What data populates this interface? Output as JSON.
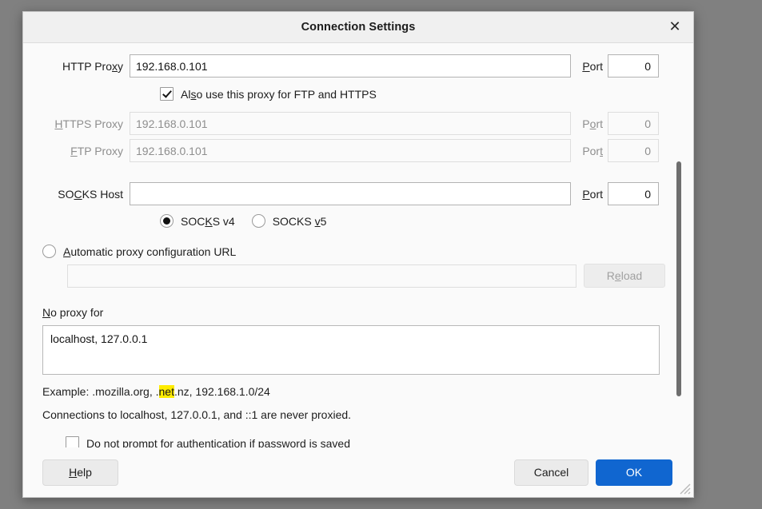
{
  "window": {
    "title": "Connection Settings",
    "close_icon": "close-icon",
    "close_label": "✕"
  },
  "proxy": {
    "http": {
      "label_pre": "HTTP Pro",
      "label_acc": "x",
      "label_post": "y",
      "value": "192.168.0.101",
      "port_pre": "",
      "port_acc": "P",
      "port_post": "ort",
      "port_value": "0"
    },
    "also_use": {
      "pre": "Al",
      "acc": "s",
      "post": "o use this proxy for FTP and HTTPS",
      "checked": true
    },
    "https": {
      "label_pre": "",
      "label_acc": "H",
      "label_post": "TTPS Proxy",
      "value": "192.168.0.101",
      "port_pre": "P",
      "port_acc": "o",
      "port_post": "rt",
      "port_value": "0",
      "disabled": true
    },
    "ftp": {
      "label_pre": "",
      "label_acc": "F",
      "label_post": "TP Proxy",
      "value": "192.168.0.101",
      "port_pre": "Por",
      "port_acc": "t",
      "port_post": "",
      "port_value": "0",
      "disabled": true
    },
    "socks": {
      "label_pre": "SO",
      "label_acc": "C",
      "label_post": "KS Host",
      "value": "",
      "port_pre": "",
      "port_acc": "P",
      "port_post": "ort",
      "port_value": "0"
    },
    "socks_v4": {
      "pre": "SOC",
      "acc": "K",
      "post": "S v4",
      "selected": true
    },
    "socks_v5": {
      "pre": "SOCKS ",
      "acc": "v",
      "post": "5",
      "selected": false
    }
  },
  "auto_config": {
    "radio_pre": "",
    "radio_acc": "A",
    "radio_post": "utomatic proxy configuration URL",
    "selected": false,
    "url_value": "",
    "reload_pre": "R",
    "reload_acc": "e",
    "reload_post": "load",
    "disabled": true
  },
  "no_proxy": {
    "label_pre": "",
    "label_acc": "N",
    "label_post": "o proxy for",
    "value": "localhost, 127.0.0.1",
    "example_pre": "Example: .mozilla.org, .",
    "example_highlight": "net",
    "example_post": ".nz, 192.168.1.0/24",
    "highlight_color": "#ffec00",
    "never_proxied": "Connections to localhost, 127.0.0.1, and ::1 are never proxied."
  },
  "no_prompt": {
    "pre": "Do not prompt for authent",
    "acc": "i",
    "post": "cation if password is saved",
    "checked": false
  },
  "footer": {
    "help_pre": "",
    "help_acc": "H",
    "help_post": "elp",
    "cancel_label": "Cancel",
    "ok_label": "OK",
    "ok_color": "#1066d0"
  }
}
